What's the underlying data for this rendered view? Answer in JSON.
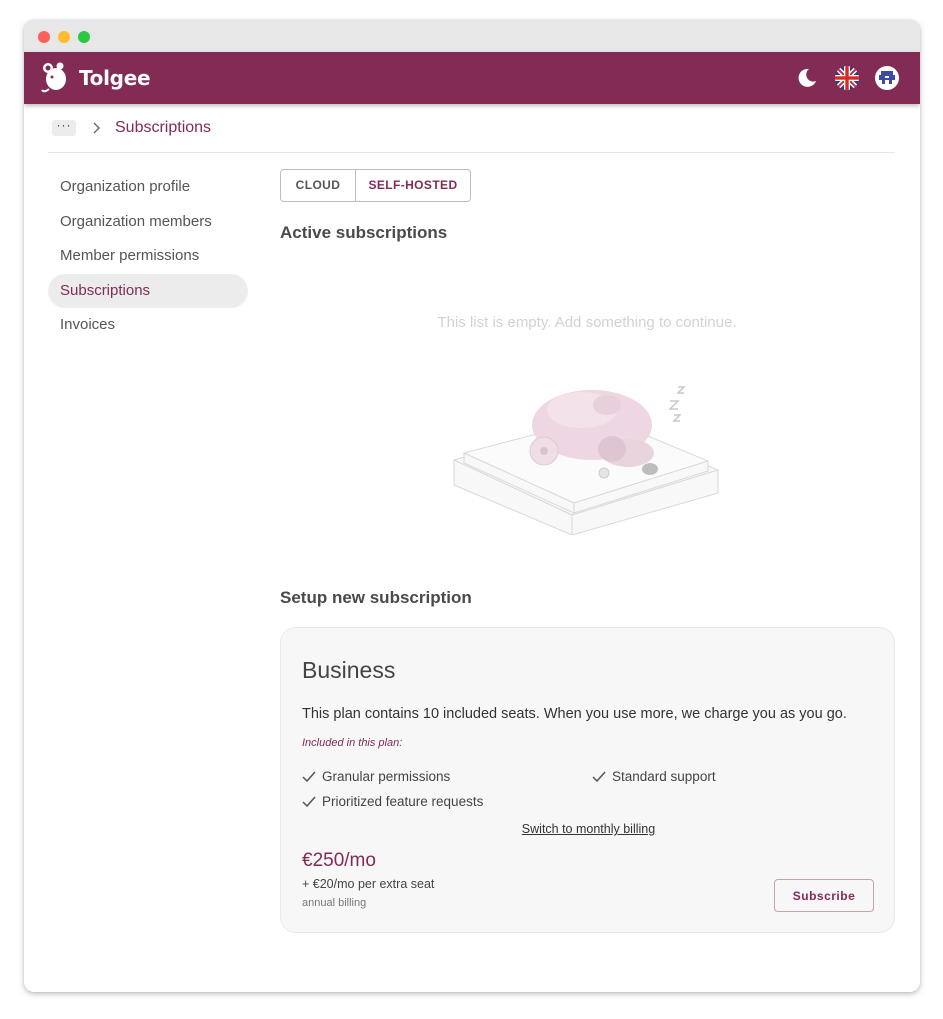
{
  "app": {
    "brand": "Tolgee",
    "accent_color": "#822b55",
    "icons": {
      "theme": "moon-icon",
      "language": "uk-flag-icon",
      "user": "user-avatar-icon"
    }
  },
  "breadcrumb": {
    "ellipsis": "···",
    "current": "Subscriptions"
  },
  "sidebar": {
    "items": [
      {
        "label": "Organization profile",
        "active": false
      },
      {
        "label": "Organization members",
        "active": false
      },
      {
        "label": "Member permissions",
        "active": false
      },
      {
        "label": "Subscriptions",
        "active": true
      },
      {
        "label": "Invoices",
        "active": false
      }
    ]
  },
  "toggle": {
    "cloud": "Cloud",
    "self_hosted": "Self-hosted",
    "selected": "self_hosted"
  },
  "active_subscriptions": {
    "title": "Active subscriptions",
    "empty_message": "This list is empty. Add something to continue."
  },
  "setup": {
    "title": "Setup new subscription",
    "plan": {
      "name": "Business",
      "description": "This plan contains 10 included seats. When you use more, we charge you as you go.",
      "included_label": "Included in this plan:",
      "features": [
        "Granular permissions",
        "Prioritized feature requests",
        "Standard support"
      ],
      "switch_billing": "Switch to monthly billing",
      "price": "€250/mo",
      "extra_seat": "+ €20/mo per extra seat",
      "billing_note": "annual billing",
      "subscribe_label": "Subscribe"
    }
  }
}
